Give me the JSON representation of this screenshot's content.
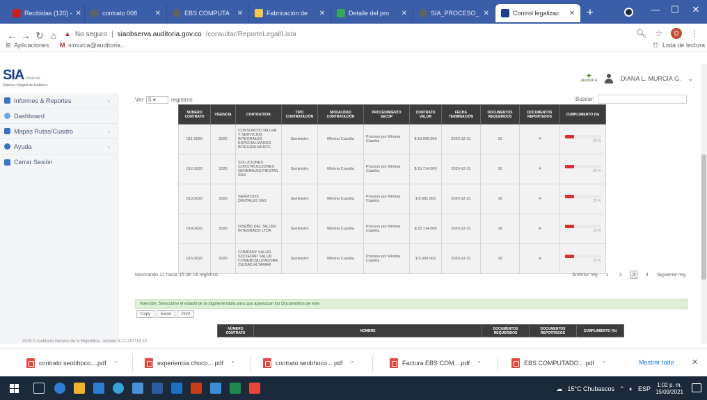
{
  "browser": {
    "tabs": [
      {
        "label": "Recibidas (120) -",
        "color": "#c5221f"
      },
      {
        "label": "contrato 008",
        "color": "#5f6368"
      },
      {
        "label": "EBS COMPUTA",
        "color": "#5f6368"
      },
      {
        "label": "Fabricación de",
        "color": "#f2c94c"
      },
      {
        "label": "Detalle del pro",
        "color": "#34a853"
      },
      {
        "label": "SIA_PROCESO_",
        "color": "#5f6368"
      },
      {
        "label": "Control legalizac",
        "color": "#1d3f8f"
      }
    ],
    "new_tab": "+",
    "window_controls": {
      "minimize": "—",
      "maximize": "☐",
      "close": "✕"
    },
    "address": {
      "security": "No seguro",
      "host": "siaobserva.auditoria.gov.co",
      "path": "/consultar/ReporteLegal/Lista"
    },
    "bookmarks": {
      "apps": "Aplicaciones",
      "gmail": "simurca@auditoria...",
      "reading_list": "Lista de lectura"
    }
  },
  "app": {
    "logo": "SIA",
    "logo_suffix": "observa",
    "logo_subtitle": "Sistema Integral de Auditoría",
    "auditoria_badge": "auditoría",
    "user_name": "DIANA L. MURCIA G."
  },
  "sidebar": {
    "items": [
      {
        "label": "Informes & Reportes",
        "has_chevron": true,
        "icon_color": "#3b73c6"
      },
      {
        "label": "Dashboard",
        "has_chevron": false,
        "icon_color": "#6aa6e8"
      },
      {
        "label": "Mapas Rutas/Cuadro",
        "has_chevron": true,
        "icon_color": "#3b73c6"
      },
      {
        "label": "Ayuda",
        "has_chevron": true,
        "icon_color": "#3b73c6"
      },
      {
        "label": "Cerrar Sesión",
        "has_chevron": false,
        "icon_color": "#3b73c6"
      }
    ]
  },
  "table_controls": {
    "show_label": "Ver",
    "show_value": "5",
    "records_label": "registros",
    "search_label": "Buscar:",
    "search_value": ""
  },
  "table": {
    "columns": [
      "NÚMERO CONTRATO",
      "VIGENCIA",
      "CONTRATISTA",
      "TIPO CONTRATACIÓN",
      "MODALIDAD CONTRATACIÓN",
      "PROCEDIMIENTO SECOP",
      "CONTRATO VALOR",
      "FECHA TERMINACIÓN",
      "DOCUMENTOS REQUERIDOS",
      "DOCUMENTOS REPORTADOS",
      "CUMPLIMIENTO (%)"
    ],
    "rows": [
      {
        "numero": "011-2020",
        "vigencia": "2020",
        "contratista": "CONSORCIO TALLER Y SERVICIOS INTEGRALES ESPECIALIZADOS INTEGRALMENTE",
        "tipo": "Suministro",
        "modalidad": "Mínima Cuantía",
        "procedimiento": "Proceso por Mínima Cuantía",
        "valor": "$ 19.000.000",
        "fecha": "2020-12-31",
        "requeridos": "16",
        "reportados": "4",
        "cumplimiento": 25,
        "cumplimiento_label": "25 %"
      },
      {
        "numero": "012-2020",
        "vigencia": "2020",
        "contratista": "SOLUCIONES CONSTRUCCIONES GENERALES FIESTAS SAS",
        "tipo": "Suministro",
        "modalidad": "Mínima Cuantía",
        "procedimiento": "Proceso por Mínima Cuantía",
        "valor": "$ 15.714.000",
        "fecha": "2020-12-31",
        "requeridos": "16",
        "reportados": "4",
        "cumplimiento": 25,
        "cumplimiento_label": "25 %"
      },
      {
        "numero": "013-2020",
        "vigencia": "2020",
        "contratista": "SERVICIOS DIGITALES SAS",
        "tipo": "Suministro",
        "modalidad": "Mínima Cuantía",
        "procedimiento": "Proceso por Mínima Cuantía",
        "valor": "$ 8.991.000",
        "fecha": "2020-12-31",
        "requeridos": "16",
        "reportados": "4",
        "cumplimiento": 25,
        "cumplimiento_label": "25 %"
      },
      {
        "numero": "014-2020",
        "vigencia": "2020",
        "contratista": "DISEÑO DEL TALLER INTEGRADO LTDA",
        "tipo": "Suministro",
        "modalidad": "Mínima Cuantía",
        "procedimiento": "Proceso por Mínima Cuantía",
        "valor": "$ 22.714.000",
        "fecha": "2020-12-31",
        "requeridos": "16",
        "reportados": "4",
        "cumplimiento": 25,
        "cumplimiento_label": "25 %"
      },
      {
        "numero": "015-2020",
        "vigencia": "2020",
        "contratista": "COMPANY SALUD SOCIEDAD SALUD COMERCIALIZADORA CIUDAD ALTAMAR",
        "tipo": "Suministro",
        "modalidad": "Mínima Cuantía",
        "procedimiento": "Proceso por Mínima Cuantía",
        "valor": "$ 5.000.000",
        "fecha": "2020-12-31",
        "requeridos": "16",
        "reportados": "4",
        "cumplimiento": 25,
        "cumplimiento_label": "25 %"
      }
    ]
  },
  "pagination": {
    "info": "Mostrando 11 hasta 15 de 18 registros",
    "previous": "Anterior reg",
    "pages": [
      "1",
      "2",
      "3",
      "4"
    ],
    "current_page": "3",
    "next": "Siguiente reg"
  },
  "alert": {
    "text": "Atención: Seleccione el estado de la siguiente tabla para que aparezcan los Documentos de este"
  },
  "buttons": {
    "copy": "Copy",
    "excel": "Excel",
    "print": "Print"
  },
  "table2": {
    "columns": [
      "NÚMERO CONTRATO",
      "NOMBRE",
      "DOCUMENTOS REQUERIDOS",
      "DOCUMENTOS REPORTADOS",
      "CUMPLIMIENTO (%)"
    ]
  },
  "footer": {
    "text": "2019 © Auditoría General de la República - versión 4.12.210718.23"
  },
  "downloads": {
    "items": [
      {
        "name": "contrato seobhoco....pdf"
      },
      {
        "name": "experiencia choco....pdf"
      },
      {
        "name": "contrato seobhoco....pdf"
      },
      {
        "name": "Factura EBS COM....pdf"
      },
      {
        "name": "EBS COMPUTADO....pdf"
      }
    ],
    "show_all": "Mostrar todo",
    "close": "✕"
  },
  "taskbar": {
    "weather": "15°C Chubascos",
    "time": "1:02 p. m.",
    "date": "15/09/2021",
    "lang": "ESP"
  }
}
